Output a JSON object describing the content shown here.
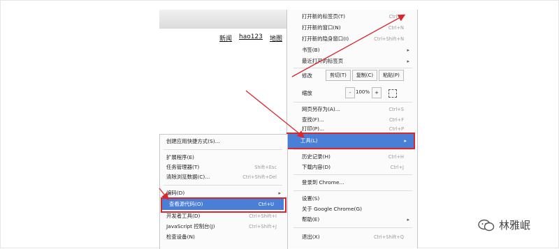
{
  "browser": {
    "star_glyph": "☆",
    "page_links": [
      "新闻",
      "hao123",
      "地图"
    ]
  },
  "main_menu": {
    "group1": [
      {
        "label": "打开新的标签页(T)",
        "shortcut": "Ctrl+T"
      },
      {
        "label": "打开新的窗口(N)",
        "shortcut": "Ctrl+N"
      },
      {
        "label": "打开新的隐身窗口(I)",
        "shortcut": "Ctrl+Shift+N"
      },
      {
        "label": "书签(B)",
        "submenu": true
      },
      {
        "label": "最近打开的标签页",
        "submenu": true
      }
    ],
    "edit": {
      "label": "修改",
      "cut": "剪切(T)",
      "copy": "复制(C)",
      "paste": "粘贴(P)"
    },
    "zoom": {
      "label": "缩放",
      "minus": "-",
      "value": "100%",
      "plus": "+"
    },
    "group3": [
      {
        "label": "网页另存为(A)...",
        "shortcut": "Ctrl+S"
      },
      {
        "label": "查找(F)...",
        "shortcut": "Ctrl+F"
      },
      {
        "label": "打印(P)...",
        "shortcut": "Ctrl+P"
      }
    ],
    "tools": {
      "label": "工具(L)",
      "arrow": "▸"
    },
    "group4": [
      {
        "label": "历史记录(H)",
        "shortcut": "Ctrl+H"
      },
      {
        "label": "下载内容(D)",
        "shortcut": "Ctrl+J"
      }
    ],
    "signin": "登录到 Chrome...",
    "group5": [
      {
        "label": "设置(S)"
      },
      {
        "label": "关于 Google Chrome(G)"
      },
      {
        "label": "帮助(E)",
        "submenu": true
      }
    ],
    "exit": {
      "label": "退出(X)",
      "shortcut": "Ctrl+Shift+Q"
    }
  },
  "tools_submenu": {
    "create_shortcuts": "创建应用快捷方式(S)...",
    "group2": [
      {
        "label": "扩展程序(E)"
      },
      {
        "label": "任务管理器(T)",
        "shortcut": "Shift+Esc"
      },
      {
        "label": "清除浏览数据(C)...",
        "shortcut": "Ctrl+Shift+Del"
      }
    ],
    "encoding": {
      "label": "编码(D)",
      "arrow": "▸"
    },
    "view_source": {
      "label": "查看源代码(O)",
      "shortcut": "Ctrl+U"
    },
    "group3": [
      {
        "label": "开发者工具(D)",
        "shortcut": "Ctrl+Shift+I"
      },
      {
        "label": "JavaScript 控制台(J)",
        "shortcut": "Ctrl+Shift+J"
      },
      {
        "label": "检查设备(N)"
      }
    ]
  },
  "watermark": {
    "text": "林雅岷",
    "icon": "wechat-bubbles-icon"
  },
  "colors": {
    "highlight": "#4a7fd8",
    "annotation_red": "#d9272e"
  }
}
